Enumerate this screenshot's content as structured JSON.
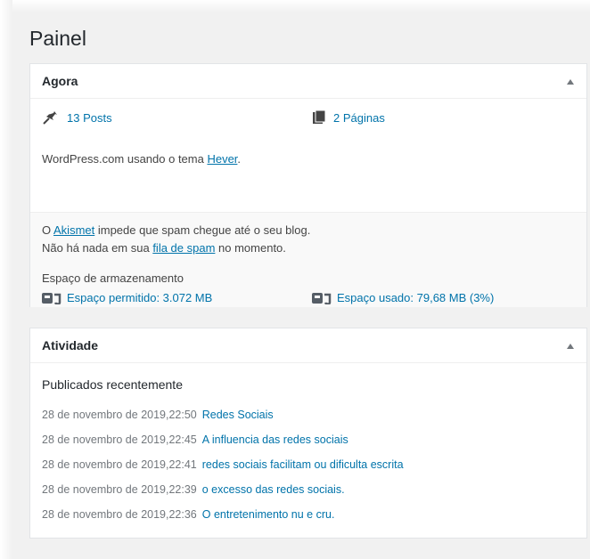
{
  "page": {
    "title": "Painel"
  },
  "glance": {
    "title": "Agora",
    "posts": "13 Posts",
    "pages": "2 Páginas",
    "theme_prefix": "WordPress.com usando o tema ",
    "theme_name": "Hever",
    "theme_suffix": ".",
    "akismet_prefix": "O ",
    "akismet_link": "Akismet",
    "akismet_suffix": " impede que spam chegue até o seu blog.",
    "spam_prefix": "Não há nada em sua ",
    "spam_link": "fila de spam",
    "spam_suffix": " no momento.",
    "storage_title": "Espaço de armazenamento",
    "storage_allowed": "Espaço permitido: 3.072 MB",
    "storage_used": "Espaço usado: 79,68 MB (3%)"
  },
  "activity": {
    "title": "Atividade",
    "section_title": "Publicados recentemente",
    "items": [
      {
        "date": "28 de novembro de 2019,22:50",
        "title": "Redes Sociais"
      },
      {
        "date": "28 de novembro de 2019,22:45",
        "title": "A influencia das redes sociais"
      },
      {
        "date": "28 de novembro de 2019,22:41",
        "title": "redes sociais facilitam ou dificulta escrita"
      },
      {
        "date": "28 de novembro de 2019,22:39",
        "title": "o excesso das redes sociais."
      },
      {
        "date": "28 de novembro de 2019,22:36",
        "title": "O entretenimento nu e cru."
      }
    ]
  },
  "colors": {
    "link": "#0073aa",
    "text": "#444444",
    "muted": "#72777c",
    "background": "#f1f1f1"
  },
  "icons": {
    "posts": "pin-icon",
    "pages": "pages-icon",
    "storage": "database-icon",
    "toggle": "triangle-up-icon"
  }
}
